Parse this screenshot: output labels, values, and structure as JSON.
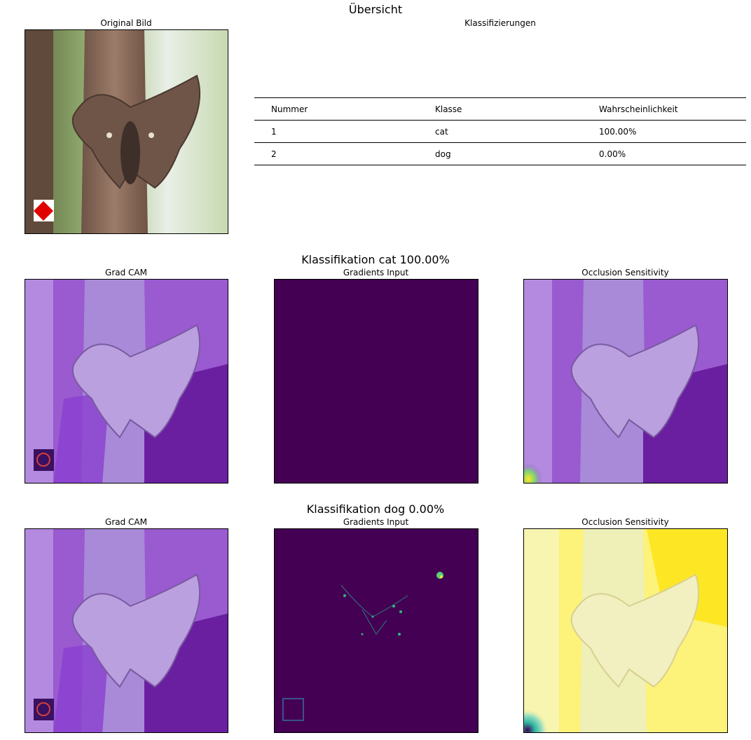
{
  "overview": {
    "title": "Übersicht",
    "original_title": "Original Bild",
    "table_title": "Klassifizierungen",
    "table": {
      "headers": [
        "Nummer",
        "Klasse",
        "Wahrscheinlichkeit"
      ],
      "rows": [
        [
          "1",
          "cat",
          "100.00%"
        ],
        [
          "2",
          "dog",
          "0.00%"
        ]
      ]
    }
  },
  "sections": [
    {
      "title": "Klassifikation cat 100.00%",
      "panels": [
        "Grad CAM",
        "Gradients Input",
        "Occlusion Sensitivity"
      ]
    },
    {
      "title": "Klassifikation dog 0.00%",
      "panels": [
        "Grad CAM",
        "Gradients Input",
        "Occlusion Sensitivity"
      ]
    }
  ],
  "colors": {
    "viridis_dark": "#440154",
    "heatmap_yellow": "#fde725",
    "overlay_purple": "#b06fe0"
  }
}
